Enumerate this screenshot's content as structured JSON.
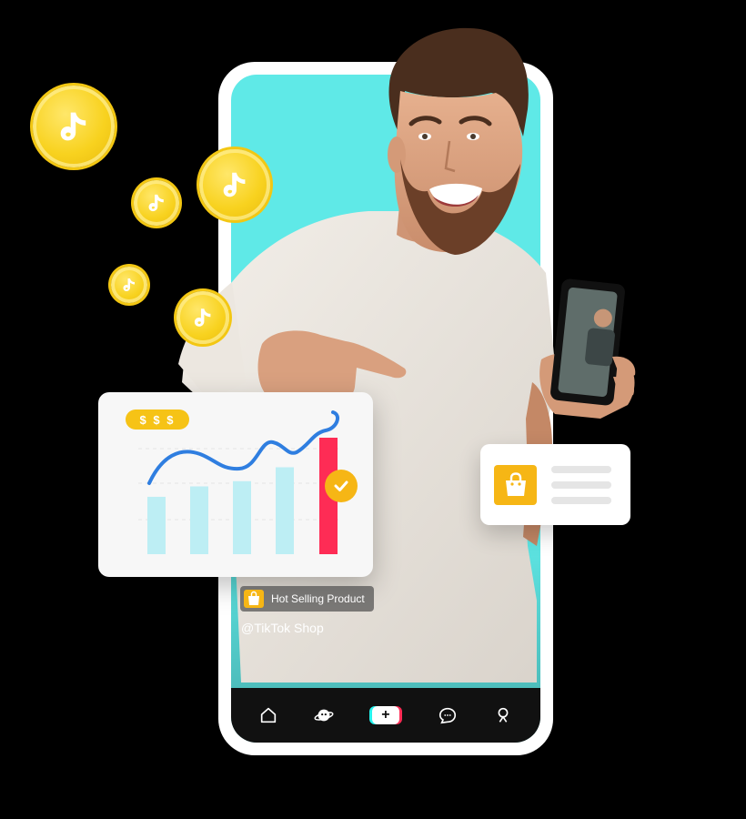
{
  "chart_card": {
    "money_label": "$ $ $"
  },
  "video": {
    "product_tag_label": "Hot Selling Product",
    "handle": "@TikTok Shop"
  },
  "bottom_nav": {
    "items": [
      "home-icon",
      "discover-icon",
      "create-icon",
      "inbox-icon",
      "profile-icon"
    ]
  },
  "colors": {
    "screen_bg": "#5fe9e7",
    "coin": "#f8d21f",
    "accent_yellow": "#f6b615",
    "chart_line": "#2f7ee0",
    "bar_light": "#bdeef4",
    "bar_highlight": "#fe2c55",
    "nav_bg": "#111111"
  },
  "chart_data": {
    "type": "bar",
    "values": [
      3.3,
      3.9,
      4.2,
      5.0,
      6.7
    ],
    "highlight_index": 4,
    "trend_line": true,
    "xlabel": "",
    "ylabel": ""
  }
}
